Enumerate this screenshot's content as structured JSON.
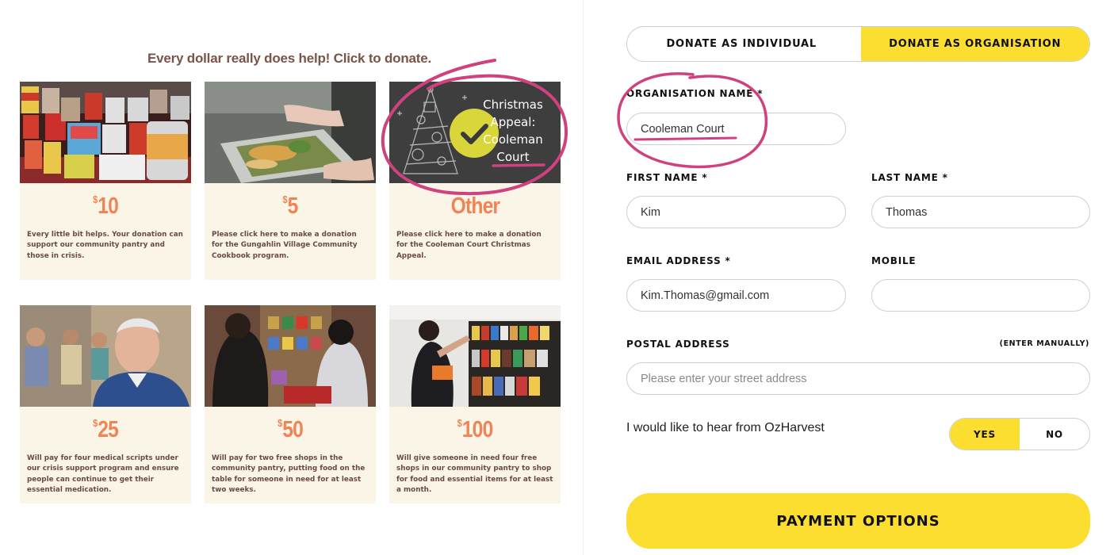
{
  "headline": "Every dollar really does help! Click to donate.",
  "cards": [
    {
      "currency": "$",
      "amount": "10",
      "desc": "Every little bit helps. Your donation can support our community pantry and those in crisis."
    },
    {
      "currency": "$",
      "amount": "5",
      "desc": "Please click here to make a donation for the Gungahlin Village Community Cookbook program."
    },
    {
      "currency": "",
      "amount": "Other",
      "desc": "Please click here to make a donation for the Cooleman Court Christmas Appeal."
    },
    {
      "currency": "$",
      "amount": "25",
      "desc": "Will pay for four medical scripts under our crisis support program and ensure people can continue to get their essential medication."
    },
    {
      "currency": "$",
      "amount": "50",
      "desc": "Will pay for two free shops in the community pantry, putting food on the table for someone in need for at least two weeks."
    },
    {
      "currency": "$",
      "amount": "100",
      "desc": "Will give someone in need four free shops in our community pantry to shop for food and essential items for at least a month."
    }
  ],
  "xmas_image_text": [
    "Christmas",
    "Appeal:",
    "Cooleman",
    "Court"
  ],
  "form": {
    "tabs": [
      {
        "label": "DONATE AS INDIVIDUAL",
        "active": false
      },
      {
        "label": "DONATE AS ORGANISATION",
        "active": true
      }
    ],
    "org_name": {
      "label": "ORGANISATION NAME *",
      "value": "Cooleman Court"
    },
    "first_name": {
      "label": "FIRST NAME *",
      "value": "Kim"
    },
    "last_name": {
      "label": "LAST NAME *",
      "value": "Thomas"
    },
    "email": {
      "label": "EMAIL ADDRESS *",
      "value": "Kim.Thomas@gmail.com"
    },
    "mobile": {
      "label": "MOBILE",
      "value": ""
    },
    "postal": {
      "label": "POSTAL ADDRESS",
      "placeholder": "Please enter your street address",
      "enter_manually": "(ENTER MANUALLY)"
    },
    "optin": {
      "text": "I would like to hear from OzHarvest",
      "yes": "YES",
      "no": "NO",
      "selected": "YES"
    },
    "submit": "PAYMENT OPTIONS"
  },
  "colors": {
    "accent_yellow": "#fbde30",
    "amount_orange": "#ef8456",
    "annotation_pink": "#d0417f",
    "card_bg": "#fbf5e8",
    "headline_brown": "#7a5349"
  }
}
